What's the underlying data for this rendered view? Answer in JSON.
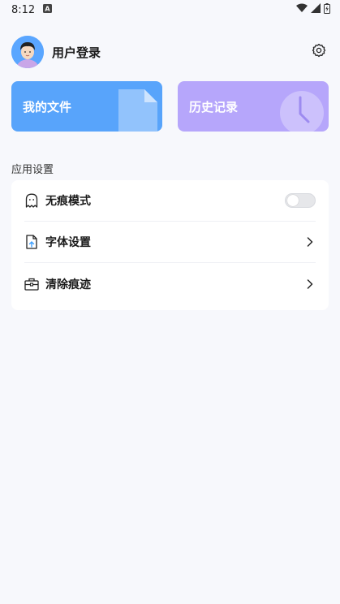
{
  "status_bar": {
    "time": "8:12"
  },
  "header": {
    "username": "用户登录"
  },
  "cards": {
    "files_label": "我的文件",
    "history_label": "历史记录",
    "files_color": "#58a4fb",
    "history_color": "#b6a6fb"
  },
  "settings": {
    "section_title": "应用设置",
    "items": [
      {
        "label": "无痕模式",
        "icon": "ghost-icon",
        "control": "toggle",
        "toggle_on": false
      },
      {
        "label": "字体设置",
        "icon": "font-file-icon",
        "control": "chevron"
      },
      {
        "label": "清除痕迹",
        "icon": "toolbox-icon",
        "control": "chevron"
      }
    ]
  }
}
